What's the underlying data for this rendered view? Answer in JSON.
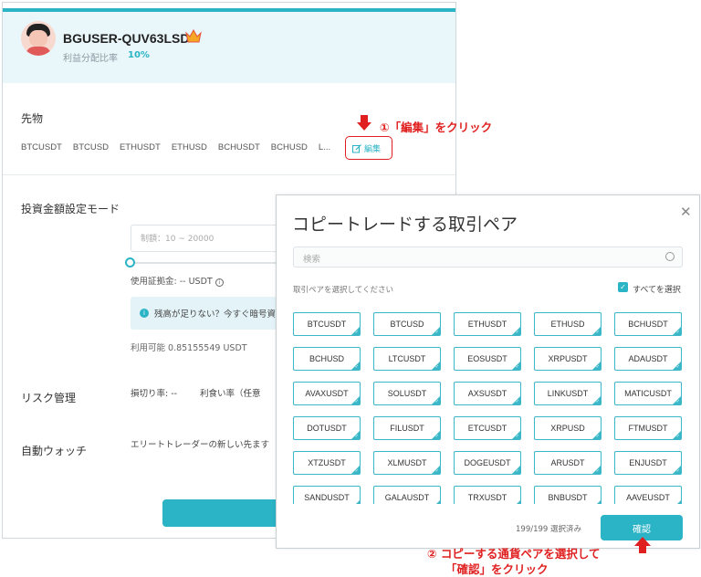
{
  "profile": {
    "username": "BGUSER-QUV63LSD",
    "profit_label": "利益分配比率",
    "profit_value": "10%"
  },
  "futures": {
    "label": "先物",
    "pairs": [
      "BTCUSDT",
      "BTCUSD",
      "ETHUSDT",
      "ETHUSD",
      "BCHUSDT",
      "BCHUSD",
      "L..."
    ],
    "edit_label": "編集"
  },
  "investment": {
    "label": "投資金額設定モード",
    "placeholder": "制額：10 ~ 20000",
    "margin_label": "使用証拠金: -- USDT",
    "info_text": "残高が足りない？今すぐ暗号資",
    "available": "利用可能 0.85155549 USDT"
  },
  "risk": {
    "label": "リスク管理",
    "stop_loss": "損切り率: --",
    "take_profit": "利食い率（任意"
  },
  "auto_watch": {
    "label": "自動ウォッチ",
    "text": "エリートトレーダーの新しい先ます"
  },
  "annotations": {
    "step1": "①「編集」をクリック",
    "step2_line1": "② コピーする通貨ペアを選択して",
    "step2_line2": "「確認」をクリック"
  },
  "modal": {
    "title": "コピートレードする取引ペア",
    "search_placeholder": "検索",
    "select_hint": "取引ペアを選択してください",
    "select_all_label": "すべてを選択",
    "pairs": [
      "BTCUSDT",
      "BTCUSD",
      "ETHUSDT",
      "ETHUSD",
      "BCHUSDT",
      "BCHUSD",
      "LTCUSDT",
      "EOSUSDT",
      "XRPUSDT",
      "ADAUSDT",
      "AVAXUSDT",
      "SOLUSDT",
      "AXSUSDT",
      "LINKUSDT",
      "MATICUSDT",
      "DOTUSDT",
      "FILUSDT",
      "ETCUSDT",
      "XRPUSD",
      "FTMUSDT",
      "XTZUSDT",
      "XLMUSDT",
      "DOGEUSDT",
      "ARUSDT",
      "ENJUSDT",
      "SANDUSDT",
      "GALAUSDT",
      "TRXUSDT",
      "BNBUSDT",
      "AAVEUSDT"
    ],
    "count": "199/199 選択済み",
    "confirm_label": "確認"
  },
  "colors": {
    "accent": "#2bb3c6",
    "annotation": "#e02020"
  }
}
